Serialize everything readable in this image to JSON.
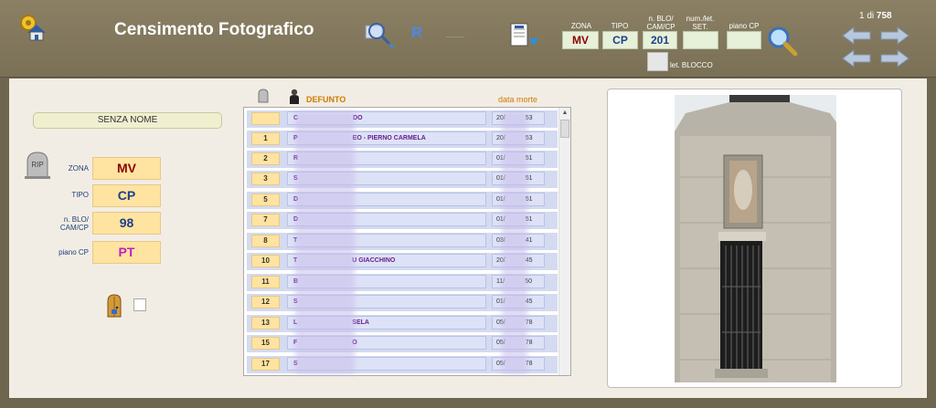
{
  "header": {
    "title": "Censimento Fotografico",
    "search_mode_label": "R",
    "fields": {
      "zona": {
        "label": "ZONA",
        "value": "MV"
      },
      "tipo": {
        "label": "TIPO",
        "value": "CP"
      },
      "blo": {
        "label": "n. BLO/ CAM/CP",
        "value": "201"
      },
      "num": {
        "label": "num./let. SET.",
        "value": ""
      },
      "piano": {
        "label": "piano CP",
        "value": ""
      },
      "blocco": {
        "label": "let. BLOCCO"
      }
    },
    "pager": {
      "current": "1",
      "sep": "di",
      "total": "758"
    }
  },
  "detail": {
    "name": "SENZA NOME",
    "zona": {
      "label": "ZONA",
      "value": "MV",
      "color": "#8b0000"
    },
    "tipo": {
      "label": "TIPO",
      "value": "CP",
      "color": "#1f3f8a"
    },
    "blo": {
      "label": "n. BLO/ CAM/CP",
      "value": "98",
      "color": "#1f3f8a"
    },
    "piano": {
      "label": "piano CP",
      "value": "PT",
      "color": "#c020c0"
    }
  },
  "list": {
    "columns": {
      "defunto": "DEFUNTO",
      "data_morte": "data morte"
    },
    "rows": [
      {
        "num": "",
        "name": "C",
        "suffix": "DO",
        "date": "20/",
        "year": "53"
      },
      {
        "num": "1",
        "name": "P",
        "suffix": "EO - PIERNO CARMELA",
        "date": "20/",
        "year": "53"
      },
      {
        "num": "2",
        "name": "R",
        "suffix": "",
        "date": "01/",
        "year": "51"
      },
      {
        "num": "3",
        "name": "S",
        "suffix": "",
        "date": "01/",
        "year": "51"
      },
      {
        "num": "5",
        "name": "D",
        "suffix": "",
        "date": "01/",
        "year": "51"
      },
      {
        "num": "7",
        "name": "D",
        "suffix": "",
        "date": "01/",
        "year": "51"
      },
      {
        "num": "8",
        "name": "T",
        "suffix": "",
        "date": "03/",
        "year": "41"
      },
      {
        "num": "10",
        "name": "T",
        "suffix": "U GIACCHINO",
        "date": "20/",
        "year": "45"
      },
      {
        "num": "11",
        "name": "B",
        "suffix": "",
        "date": "11/",
        "year": "50"
      },
      {
        "num": "12",
        "name": "S",
        "suffix": "",
        "date": "01/",
        "year": "45"
      },
      {
        "num": "13",
        "name": "L",
        "suffix": "SELA",
        "date": "05/",
        "year": "78"
      },
      {
        "num": "15",
        "name": "F",
        "suffix": "O",
        "date": "05/",
        "year": "78"
      },
      {
        "num": "17",
        "name": "S",
        "suffix": "",
        "date": "05/",
        "year": "78"
      }
    ]
  },
  "icons": {
    "home": "home-settings-icon",
    "search_photo": "magnify-photo-icon",
    "doc_export": "document-export-icon",
    "search": "search-icon",
    "rip": "tombstone-icon",
    "door": "door-icon"
  }
}
